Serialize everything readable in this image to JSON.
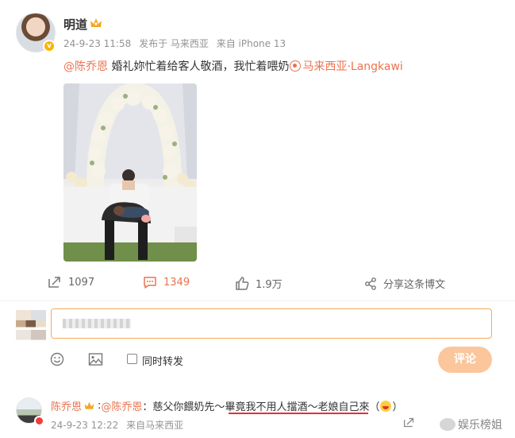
{
  "post": {
    "author": "明道",
    "time": "24-9-23 11:58",
    "location_meta": "发布于 马来西亚",
    "device": "来自 iPhone 13",
    "mention": "@陈乔恩",
    "text": " 婚礼妳忙着给客人敬酒，我忙着喂奶",
    "location_tag": "马来西亚·Langkawi"
  },
  "actions": {
    "repost_count": "1097",
    "comment_count": "1349",
    "like_count": "1.9万",
    "share_label": "分享这条博文"
  },
  "composer": {
    "sync_label": "同时转发",
    "submit_label": "评论"
  },
  "comment": {
    "author": "陈乔恩",
    "separator": " :",
    "mention": "@陈乔恩",
    "text_before": "：慈父你餵奶先～",
    "text_underlined": "畢竟我不用人擋酒",
    "text_after": "～老娘自己來（",
    "text_end": "）",
    "time": "24-9-23 12:22",
    "location": "来自马来西亚"
  },
  "watermark": "娱乐榜姐",
  "colors": {
    "accent": "#eb7350",
    "input_border": "#f5a95b",
    "button": "#fbc69c",
    "underline": "#e63030"
  }
}
